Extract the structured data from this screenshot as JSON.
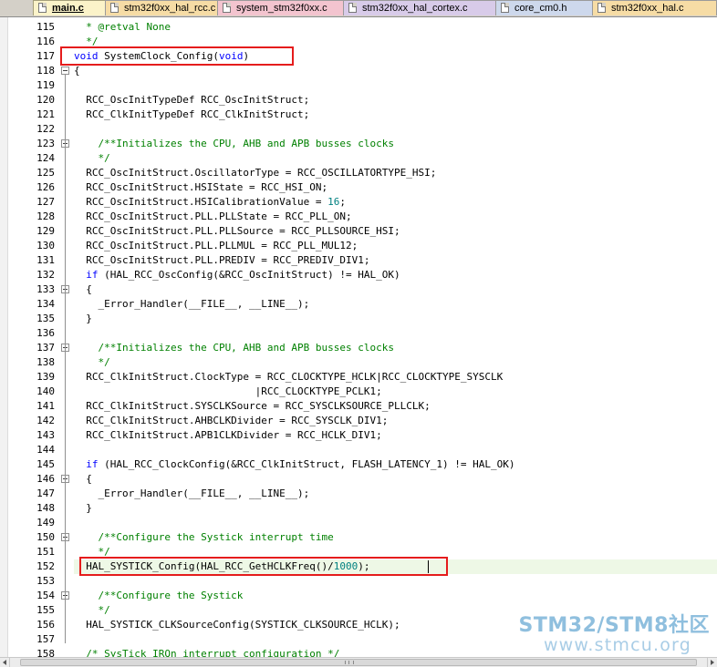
{
  "tabs": [
    {
      "label": "main.c",
      "active": true
    },
    {
      "label": "stm32f0xx_hal_rcc.c",
      "active": false
    },
    {
      "label": "system_stm32f0xx.c",
      "active": false
    },
    {
      "label": "stm32f0xx_hal_cortex.c",
      "active": false
    },
    {
      "label": "core_cm0.h",
      "active": false
    },
    {
      "label": "stm32f0xx_hal.c",
      "active": false
    }
  ],
  "tab_colors": [
    "#fbf3c9",
    "#f6dca5",
    "#f3c4cf",
    "#d8cbe9",
    "#cdd8ec",
    "#f6dca5"
  ],
  "editor": {
    "first_line": 115,
    "lines": [
      {
        "n": "115",
        "t": "  * @retval None",
        "style": "comment"
      },
      {
        "n": "116",
        "t": "  */",
        "style": "comment"
      },
      {
        "n": "117",
        "t": "void SystemClock_Config(void)",
        "style": "code"
      },
      {
        "n": "118",
        "t": "{",
        "style": "code",
        "fold": true
      },
      {
        "n": "119",
        "t": "",
        "style": "code"
      },
      {
        "n": "120",
        "t": "  RCC_OscInitTypeDef RCC_OscInitStruct;",
        "style": "code"
      },
      {
        "n": "121",
        "t": "  RCC_ClkInitTypeDef RCC_ClkInitStruct;",
        "style": "code"
      },
      {
        "n": "122",
        "t": "",
        "style": "code"
      },
      {
        "n": "123",
        "t": "    /**Initializes the CPU, AHB and APB busses clocks",
        "style": "comment",
        "fold": true
      },
      {
        "n": "124",
        "t": "    */",
        "style": "comment"
      },
      {
        "n": "125",
        "t": "  RCC_OscInitStruct.OscillatorType = RCC_OSCILLATORTYPE_HSI;",
        "style": "code"
      },
      {
        "n": "126",
        "t": "  RCC_OscInitStruct.HSIState = RCC_HSI_ON;",
        "style": "code"
      },
      {
        "n": "127",
        "t": "  RCC_OscInitStruct.HSICalibrationValue = 16;",
        "style": "code"
      },
      {
        "n": "128",
        "t": "  RCC_OscInitStruct.PLL.PLLState = RCC_PLL_ON;",
        "style": "code"
      },
      {
        "n": "129",
        "t": "  RCC_OscInitStruct.PLL.PLLSource = RCC_PLLSOURCE_HSI;",
        "style": "code"
      },
      {
        "n": "130",
        "t": "  RCC_OscInitStruct.PLL.PLLMUL = RCC_PLL_MUL12;",
        "style": "code"
      },
      {
        "n": "131",
        "t": "  RCC_OscInitStruct.PLL.PREDIV = RCC_PREDIV_DIV1;",
        "style": "code"
      },
      {
        "n": "132",
        "t": "  if (HAL_RCC_OscConfig(&RCC_OscInitStruct) != HAL_OK)",
        "style": "code"
      },
      {
        "n": "133",
        "t": "  {",
        "style": "code",
        "fold": true
      },
      {
        "n": "134",
        "t": "    _Error_Handler(__FILE__, __LINE__);",
        "style": "code"
      },
      {
        "n": "135",
        "t": "  }",
        "style": "code"
      },
      {
        "n": "136",
        "t": "",
        "style": "code"
      },
      {
        "n": "137",
        "t": "    /**Initializes the CPU, AHB and APB busses clocks",
        "style": "comment",
        "fold": true
      },
      {
        "n": "138",
        "t": "    */",
        "style": "comment"
      },
      {
        "n": "139",
        "t": "  RCC_ClkInitStruct.ClockType = RCC_CLOCKTYPE_HCLK|RCC_CLOCKTYPE_SYSCLK",
        "style": "code"
      },
      {
        "n": "140",
        "t": "                              |RCC_CLOCKTYPE_PCLK1;",
        "style": "code"
      },
      {
        "n": "141",
        "t": "  RCC_ClkInitStruct.SYSCLKSource = RCC_SYSCLKSOURCE_PLLCLK;",
        "style": "code"
      },
      {
        "n": "142",
        "t": "  RCC_ClkInitStruct.AHBCLKDivider = RCC_SYSCLK_DIV1;",
        "style": "code"
      },
      {
        "n": "143",
        "t": "  RCC_ClkInitStruct.APB1CLKDivider = RCC_HCLK_DIV1;",
        "style": "code"
      },
      {
        "n": "144",
        "t": "",
        "style": "code"
      },
      {
        "n": "145",
        "t": "  if (HAL_RCC_ClockConfig(&RCC_ClkInitStruct, FLASH_LATENCY_1) != HAL_OK)",
        "style": "code"
      },
      {
        "n": "146",
        "t": "  {",
        "style": "code",
        "fold": true
      },
      {
        "n": "147",
        "t": "    _Error_Handler(__FILE__, __LINE__);",
        "style": "code"
      },
      {
        "n": "148",
        "t": "  }",
        "style": "code"
      },
      {
        "n": "149",
        "t": "",
        "style": "code"
      },
      {
        "n": "150",
        "t": "    /**Configure the Systick interrupt time",
        "style": "comment",
        "fold": true
      },
      {
        "n": "151",
        "t": "    */",
        "style": "comment"
      },
      {
        "n": "152",
        "t": "  HAL_SYSTICK_Config(HAL_RCC_GetHCLKFreq()/1000);",
        "style": "code"
      },
      {
        "n": "153",
        "t": "",
        "style": "code"
      },
      {
        "n": "154",
        "t": "    /**Configure the Systick",
        "style": "comment",
        "fold": true
      },
      {
        "n": "155",
        "t": "    */",
        "style": "comment"
      },
      {
        "n": "156",
        "t": "  HAL_SYSTICK_CLKSourceConfig(SYSTICK_CLKSOURCE_HCLK);",
        "style": "code"
      },
      {
        "n": "157",
        "t": "",
        "style": "code"
      },
      {
        "n": "158",
        "t": "  /* SysTick_IRQn interrupt configuration */",
        "style": "comment"
      }
    ],
    "highlighted_line": "152",
    "boxed_lines": [
      "117",
      "152"
    ]
  },
  "keywords": [
    "void",
    "if"
  ],
  "watermark": {
    "top": "STM32/STM8社区",
    "bottom": "www.stmcu.org"
  },
  "colors": {
    "comment": "#008000",
    "keyword": "#0000ff",
    "number": "#008080",
    "annotation_box": "#e51c1c",
    "current_line": "#eef8e6"
  },
  "icons": [
    "file-icon",
    "fold-toggle-icon",
    "scroll-left-icon",
    "scroll-right-icon"
  ]
}
